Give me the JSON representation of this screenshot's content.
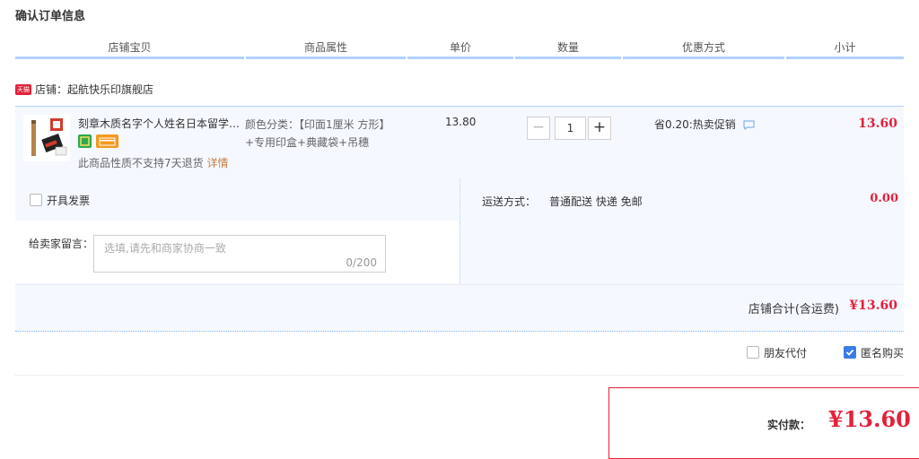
{
  "page_title": "确认订单信息",
  "columns": [
    "店铺宝贝",
    "商品属性",
    "单价",
    "数量",
    "优惠方式",
    "小计"
  ],
  "shop": {
    "badge": "天猫",
    "label": "店铺：起航快乐印旗舰店"
  },
  "item": {
    "title": "刻章木质名字个人姓名日本留学生印章定制",
    "attr_line1": "颜色分类：【印面1厘米 方形】",
    "attr_line2": "+专用印盒+典藏袋+吊穗",
    "unit_price": "13.80",
    "quantity": "1",
    "qty_minus": "−",
    "qty_plus": "+",
    "promo": "省0.20:热卖促销",
    "subtotal": "13.60",
    "return_note": "此商品性质不支持7天退货",
    "detail_link": "详情"
  },
  "options": {
    "invoice_label": "开具发票",
    "message_label": "给卖家留言：",
    "message_placeholder": "选填,请先和商家协商一致",
    "message_counter": "0/200",
    "shipping_label": "运送方式：",
    "shipping_value": "普通配送 快递 免邮",
    "shipping_fee": "0.00",
    "shop_total_label": "店铺合计(含运费)",
    "shop_total": "¥13.60"
  },
  "footer": {
    "friend_pay_label": "朋友代付",
    "anonymous_label": "匿名购买",
    "anonymous_checked": true,
    "pay_label": "实付款：",
    "pay_amount": "¥13.60"
  },
  "colors": {
    "accent_red": "#e3213a",
    "header_bar": "#b2d1ff",
    "panel_bg": "#f5f8ff",
    "checkbox_blue": "#3b7ce5"
  }
}
